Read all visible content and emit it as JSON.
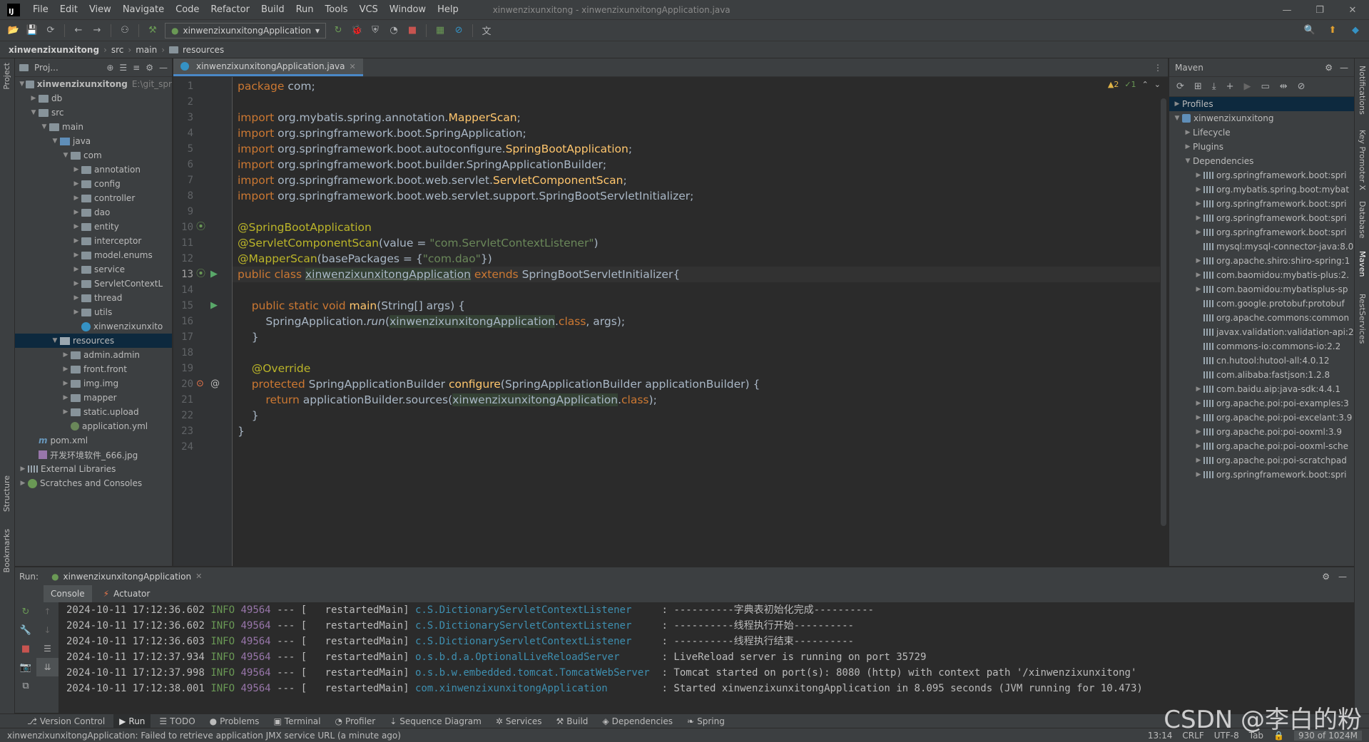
{
  "window": {
    "logo": "IJ",
    "title": "xinwenzixunxitong - xinwenzixunxitongApplication.java",
    "controls": [
      "—",
      "❐",
      "✕"
    ]
  },
  "menu": [
    "File",
    "Edit",
    "View",
    "Navigate",
    "Code",
    "Refactor",
    "Build",
    "Run",
    "Tools",
    "VCS",
    "Window",
    "Help"
  ],
  "toolbar": {
    "run_config": "xinwenzixunxitongApplication"
  },
  "breadcrumb": [
    "xinwenzixunxitong",
    "src",
    "main",
    "resources"
  ],
  "left_stripe": {
    "project": "Project",
    "structure": "Structure",
    "bookmarks": "Bookmarks"
  },
  "right_stripe": {
    "notifications": "Notifications",
    "key_promoter": "Key Promoter X",
    "database": "Database",
    "maven": "Maven",
    "rest": "RestServices"
  },
  "project": {
    "header": "Proj...",
    "tree": [
      {
        "label": "xinwenzixunxitong",
        "extra": "E:\\git_spr",
        "depth": 0,
        "open": true,
        "icon": "folder",
        "bold": true
      },
      {
        "label": "db",
        "depth": 1,
        "open": false,
        "icon": "folder"
      },
      {
        "label": "src",
        "depth": 1,
        "open": true,
        "icon": "folder"
      },
      {
        "label": "main",
        "depth": 2,
        "open": true,
        "icon": "folder"
      },
      {
        "label": "java",
        "depth": 3,
        "open": true,
        "icon": "folder-src"
      },
      {
        "label": "com",
        "depth": 4,
        "open": true,
        "icon": "folder"
      },
      {
        "label": "annotation",
        "depth": 5,
        "open": false,
        "icon": "folder"
      },
      {
        "label": "config",
        "depth": 5,
        "open": false,
        "icon": "folder"
      },
      {
        "label": "controller",
        "depth": 5,
        "open": false,
        "icon": "folder"
      },
      {
        "label": "dao",
        "depth": 5,
        "open": false,
        "icon": "folder"
      },
      {
        "label": "entity",
        "depth": 5,
        "open": false,
        "icon": "folder"
      },
      {
        "label": "interceptor",
        "depth": 5,
        "open": false,
        "icon": "folder"
      },
      {
        "label": "model.enums",
        "depth": 5,
        "open": false,
        "icon": "folder"
      },
      {
        "label": "service",
        "depth": 5,
        "open": false,
        "icon": "folder"
      },
      {
        "label": "ServletContextL",
        "depth": 5,
        "open": false,
        "icon": "folder"
      },
      {
        "label": "thread",
        "depth": 5,
        "open": false,
        "icon": "folder"
      },
      {
        "label": "utils",
        "depth": 5,
        "open": false,
        "icon": "folder"
      },
      {
        "label": "xinwenzixunxito",
        "depth": 5,
        "leaf": true,
        "icon": "java"
      },
      {
        "label": "resources",
        "depth": 3,
        "open": true,
        "icon": "folder-res",
        "selected": true
      },
      {
        "label": "admin.admin",
        "depth": 4,
        "open": false,
        "icon": "folder"
      },
      {
        "label": "front.front",
        "depth": 4,
        "open": false,
        "icon": "folder"
      },
      {
        "label": "img.img",
        "depth": 4,
        "open": false,
        "icon": "folder"
      },
      {
        "label": "mapper",
        "depth": 4,
        "open": false,
        "icon": "folder"
      },
      {
        "label": "static.upload",
        "depth": 4,
        "open": false,
        "icon": "folder"
      },
      {
        "label": "application.yml",
        "depth": 4,
        "leaf": true,
        "icon": "yml"
      },
      {
        "label": "pom.xml",
        "depth": 1,
        "leaf": true,
        "icon": "maven"
      },
      {
        "label": "开发环境软件_666.jpg",
        "depth": 1,
        "leaf": true,
        "icon": "image"
      },
      {
        "label": "External Libraries",
        "depth": 0,
        "open": false,
        "icon": "lib"
      },
      {
        "label": "Scratches and Consoles",
        "depth": 0,
        "open": false,
        "icon": "scratch"
      }
    ]
  },
  "editor": {
    "tab": "xinwenzixunxitongApplication.java",
    "inspection": {
      "warnings": "▲2",
      "ok": "✓1"
    },
    "line_numbers": [
      "1",
      "2",
      "3",
      "4",
      "5",
      "6",
      "7",
      "8",
      "9",
      "10",
      "11",
      "12",
      "13",
      "14",
      "15",
      "16",
      "17",
      "18",
      "19",
      "20",
      "21",
      "22",
      "23",
      "24"
    ],
    "current_line": "13"
  },
  "maven": {
    "title": "Maven",
    "tree": [
      {
        "label": "Profiles",
        "depth": 0,
        "open": false,
        "selected": true,
        "icon": "folder"
      },
      {
        "label": "xinwenzixunxitong",
        "depth": 0,
        "open": true,
        "icon": "maven"
      },
      {
        "label": "Lifecycle",
        "depth": 1,
        "open": false,
        "icon": "folder"
      },
      {
        "label": "Plugins",
        "depth": 1,
        "open": false,
        "icon": "folder"
      },
      {
        "label": "Dependencies",
        "depth": 1,
        "open": true,
        "icon": "folder"
      },
      {
        "label": "org.springframework.boot:spri",
        "depth": 2,
        "open": false
      },
      {
        "label": "org.mybatis.spring.boot:mybat",
        "depth": 2,
        "open": false
      },
      {
        "label": "org.springframework.boot:spri",
        "depth": 2,
        "open": false
      },
      {
        "label": "org.springframework.boot:spri",
        "depth": 2,
        "open": false
      },
      {
        "label": "org.springframework.boot:spri",
        "depth": 2,
        "open": false
      },
      {
        "label": "mysql:mysql-connector-java:8.0",
        "depth": 2,
        "leaf": true
      },
      {
        "label": "org.apache.shiro:shiro-spring:1",
        "depth": 2,
        "open": false
      },
      {
        "label": "com.baomidou:mybatis-plus:2.",
        "depth": 2,
        "open": false
      },
      {
        "label": "com.baomidou:mybatisplus-sp",
        "depth": 2,
        "open": false
      },
      {
        "label": "com.google.protobuf:protobuf",
        "depth": 2,
        "leaf": true
      },
      {
        "label": "org.apache.commons:common",
        "depth": 2,
        "leaf": true
      },
      {
        "label": "javax.validation:validation-api:2",
        "depth": 2,
        "leaf": true
      },
      {
        "label": "commons-io:commons-io:2.2",
        "depth": 2,
        "leaf": true
      },
      {
        "label": "cn.hutool:hutool-all:4.0.12",
        "depth": 2,
        "leaf": true
      },
      {
        "label": "com.alibaba:fastjson:1.2.8",
        "depth": 2,
        "leaf": true
      },
      {
        "label": "com.baidu.aip:java-sdk:4.4.1",
        "depth": 2,
        "open": false
      },
      {
        "label": "org.apache.poi:poi-examples:3",
        "depth": 2,
        "open": false
      },
      {
        "label": "org.apache.poi:poi-excelant:3.9",
        "depth": 2,
        "open": false
      },
      {
        "label": "org.apache.poi:poi-ooxml:3.9",
        "depth": 2,
        "open": false
      },
      {
        "label": "org.apache.poi:poi-ooxml-sche",
        "depth": 2,
        "open": false
      },
      {
        "label": "org.apache.poi:poi-scratchpad",
        "depth": 2,
        "open": false
      },
      {
        "label": "org.springframework.boot:spri",
        "depth": 2,
        "open": false
      }
    ]
  },
  "run": {
    "label": "Run:",
    "tab": "xinwenzixunxitongApplication",
    "subtabs": [
      "Console",
      "Actuator"
    ],
    "logs": [
      {
        "ts": "2024-10-11 17:12:36.602",
        "level": "INFO",
        "pid": "49564",
        "sep": "--- [",
        "thread": "  restartedMain]",
        "logger": "c.S.DictionaryServletContextListener    ",
        "msg": " : ----------字典表初始化完成----------"
      },
      {
        "ts": "2024-10-11 17:12:36.602",
        "level": "INFO",
        "pid": "49564",
        "sep": "--- [",
        "thread": "  restartedMain]",
        "logger": "c.S.DictionaryServletContextListener    ",
        "msg": " : ----------线程执行开始----------"
      },
      {
        "ts": "2024-10-11 17:12:36.603",
        "level": "INFO",
        "pid": "49564",
        "sep": "--- [",
        "thread": "  restartedMain]",
        "logger": "c.S.DictionaryServletContextListener    ",
        "msg": " : ----------线程执行结束----------"
      },
      {
        "ts": "2024-10-11 17:12:37.934",
        "level": "INFO",
        "pid": "49564",
        "sep": "--- [",
        "thread": "  restartedMain]",
        "logger": "o.s.b.d.a.OptionalLiveReloadServer      ",
        "msg": " : LiveReload server is running on port 35729"
      },
      {
        "ts": "2024-10-11 17:12:37.998",
        "level": "INFO",
        "pid": "49564",
        "sep": "--- [",
        "thread": "  restartedMain]",
        "logger": "o.s.b.w.embedded.tomcat.TomcatWebServer ",
        "msg": " : Tomcat started on port(s): 8080 (http) with context path '/xinwenzixunxitong'"
      },
      {
        "ts": "2024-10-11 17:12:38.001",
        "level": "INFO",
        "pid": "49564",
        "sep": "--- [",
        "thread": "  restartedMain]",
        "logger": "com.xinwenzixunxitongApplication        ",
        "msg": " : Started xinwenzixunxitongApplication in 8.095 seconds (JVM running for 10.473)"
      }
    ]
  },
  "bottom_tools": [
    {
      "label": "Version Control",
      "icon": "⎇"
    },
    {
      "label": "Run",
      "icon": "▶",
      "active": true
    },
    {
      "label": "TODO",
      "icon": "☰"
    },
    {
      "label": "Problems",
      "icon": "●"
    },
    {
      "label": "Terminal",
      "icon": "▣"
    },
    {
      "label": "Profiler",
      "icon": "◔"
    },
    {
      "label": "Sequence Diagram",
      "icon": "⇣"
    },
    {
      "label": "Services",
      "icon": "✲"
    },
    {
      "label": "Build",
      "icon": "⚒"
    },
    {
      "label": "Dependencies",
      "icon": "◈"
    },
    {
      "label": "Spring",
      "icon": "❧"
    }
  ],
  "status": {
    "message": "xinwenzixunxitongApplication: Failed to retrieve application JMX service URL (a minute ago)",
    "position": "13:14",
    "line_sep": "CRLF",
    "encoding": "UTF-8",
    "indent": "Tab",
    "memory": "930 of 1024M"
  },
  "watermark": "CSDN @李白的粉"
}
